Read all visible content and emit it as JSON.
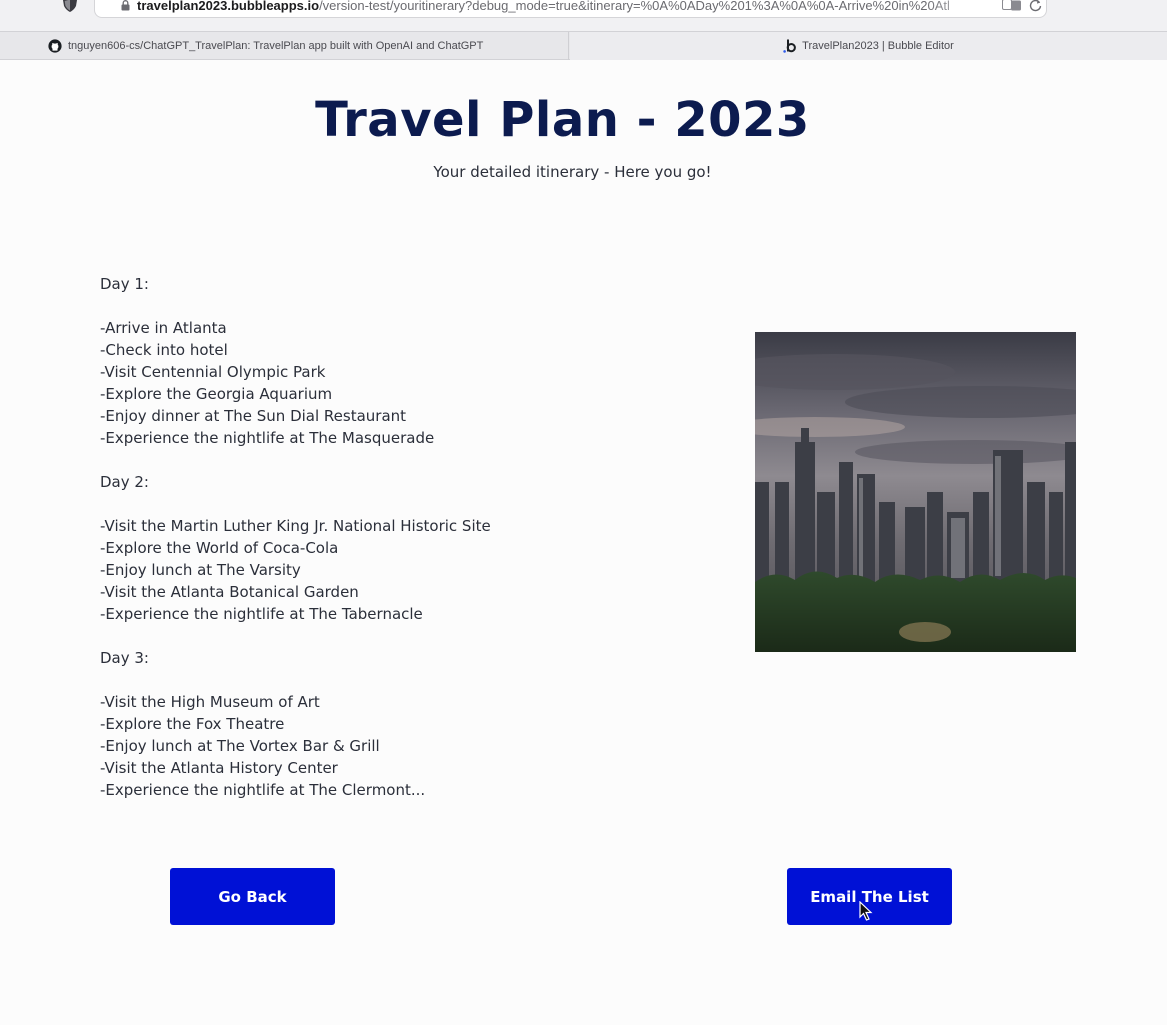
{
  "browser": {
    "url_host": "travelplan2023.bubbleapps.io",
    "url_path": "/version-test/youritinerary?debug_mode=true&itinerary=%0A%0ADay%201%3A%0A%0A-Arrive%20in%20Atl",
    "tabs": [
      {
        "label": "tnguyen606-cs/ChatGPT_TravelPlan: TravelPlan app built with OpenAI and ChatGPT",
        "icon": "github-icon"
      },
      {
        "label": "TravelPlan2023 | Bubble Editor",
        "icon": "bubble-icon"
      }
    ]
  },
  "page": {
    "title": "Travel Plan - 2023",
    "subtitle": "Your detailed itinerary - Here you go!"
  },
  "itinerary": {
    "lines": [
      "Day 1:",
      "",
      "-Arrive in Atlanta",
      "-Check into hotel",
      "-Visit Centennial Olympic Park",
      "-Explore the Georgia Aquarium",
      "-Enjoy dinner at The Sun Dial Restaurant",
      "-Experience the nightlife at The Masquerade",
      "",
      "Day 2:",
      "",
      "-Visit the Martin Luther King Jr. National Historic Site",
      "-Explore the World of Coca-Cola",
      "-Enjoy lunch at The Varsity",
      "-Visit the Atlanta Botanical Garden",
      "-Experience the nightlife at The Tabernacle",
      "",
      "Day 3:",
      "",
      "-Visit the High Museum of Art",
      "-Explore the Fox Theatre",
      "-Enjoy lunch at The Vortex Bar & Grill",
      "-Visit the Atlanta History Center",
      "-Experience the nightlife at The Clermont..."
    ]
  },
  "buttons": {
    "back_label": "Go Back",
    "email_label": "Email The List"
  },
  "colors": {
    "title": "#0c1b4f",
    "button_bg": "#0011d6",
    "button_text": "#ffffff",
    "page_bg": "#fcfcfc"
  }
}
